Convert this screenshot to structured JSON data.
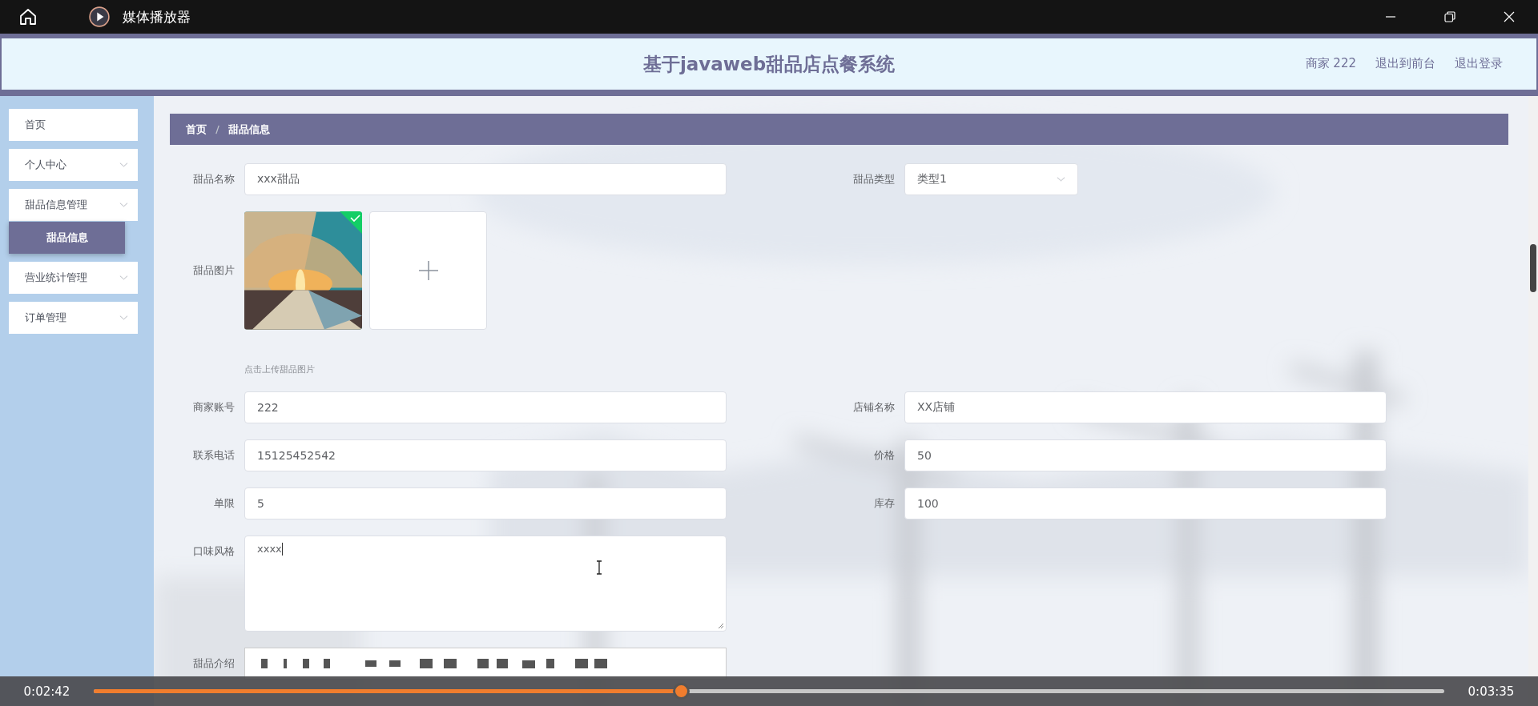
{
  "player": {
    "title": "媒体播放器",
    "time_elapsed": "0:02:42",
    "time_total": "0:03:35",
    "level": 0.43
  },
  "header": {
    "title": "基于javaweb甜品店点餐系统",
    "links": [
      "商家 222",
      "退出到前台",
      "退出登录"
    ]
  },
  "sidebar": {
    "items": [
      {
        "label": "首页"
      },
      {
        "label": "个人中心",
        "has_submenu": true
      },
      {
        "label": "甜品信息管理",
        "has_submenu": true,
        "children": [
          {
            "label": "甜品信息",
            "selected": true
          }
        ]
      },
      {
        "label": "营业统计管理",
        "has_submenu": true
      },
      {
        "label": "订单管理",
        "has_submenu": true
      }
    ]
  },
  "breadcrumb": [
    "首页",
    "甜品信息"
  ],
  "form": {
    "rows": [
      [
        {
          "kind": "text",
          "label": "甜品名称",
          "value": "xxx甜品"
        },
        {
          "kind": "select",
          "label": "甜品类型",
          "value": "类型1"
        }
      ],
      [
        {
          "label": "甜品图片",
          "hint": "点击上传甜品图片"
        }
      ],
      [
        {
          "kind": "text",
          "label": "商家账号",
          "value": "222"
        },
        {
          "kind": "text",
          "label": "店铺名称",
          "value": "XX店铺"
        }
      ],
      [
        {
          "kind": "text",
          "label": "联系电话",
          "value": "15125452542"
        },
        {
          "kind": "text",
          "label": "价格",
          "value": "50"
        }
      ],
      [
        {
          "kind": "text",
          "label": "单限",
          "value": "5"
        },
        {
          "kind": "text",
          "label": "库存",
          "value": "100"
        }
      ],
      [
        {
          "kind": "textarea",
          "label": "口味风格",
          "value": "xxxx"
        }
      ],
      [
        {
          "kind": "editor",
          "label": "甜品介绍"
        }
      ]
    ]
  }
}
